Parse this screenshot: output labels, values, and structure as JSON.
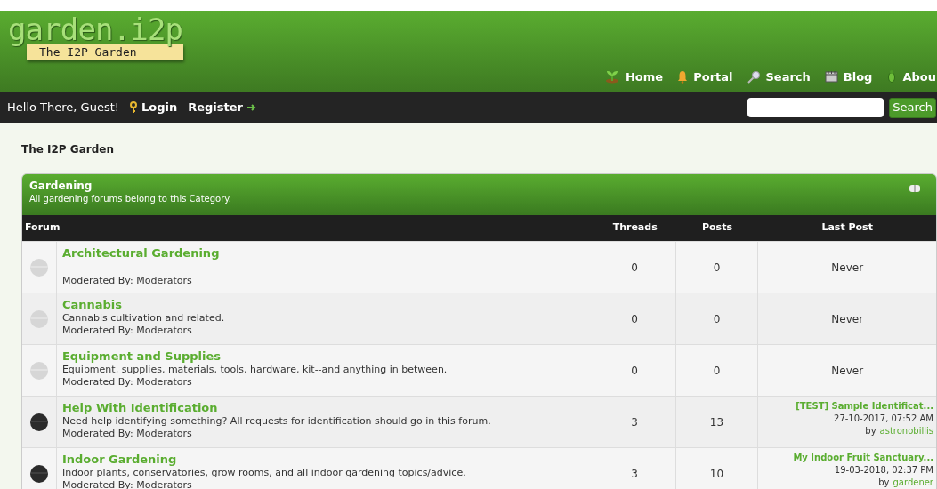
{
  "logo": {
    "title": "garden.i2p",
    "tagline": "The I2P Garden"
  },
  "nav": [
    {
      "label": "Home",
      "kind": "home"
    },
    {
      "label": "Portal",
      "kind": "portal"
    },
    {
      "label": "Search",
      "kind": "search"
    },
    {
      "label": "Blog",
      "kind": "blog"
    },
    {
      "label": "Abou",
      "kind": "about"
    }
  ],
  "user_bar": {
    "greeting": "Hello There, Guest!",
    "login": "Login",
    "register": "Register",
    "search_button": "Search"
  },
  "breadcrumb": "The I2P Garden",
  "category": {
    "title": "Gardening",
    "description": "All gardening forums belong to this Category."
  },
  "columns": [
    "Forum",
    "Threads",
    "Posts",
    "Last Post"
  ],
  "forums": [
    {
      "name": "Architectural Gardening",
      "moderators": "Moderated By: Moderators",
      "unread": false,
      "threads": "0",
      "posts": "0",
      "last_post": {
        "kind": "never",
        "text": "Never"
      }
    },
    {
      "name": "Cannabis",
      "description": "Cannabis cultivation and related.",
      "moderators": "Moderated By: Moderators",
      "unread": false,
      "threads": "0",
      "posts": "0",
      "last_post": {
        "kind": "never",
        "text": "Never"
      }
    },
    {
      "name": "Equipment and Supplies",
      "description": "Equipment, supplies, materials, tools, hardware, kit--and anything in between.",
      "moderators": "Moderated By: Moderators",
      "unread": false,
      "threads": "0",
      "posts": "0",
      "last_post": {
        "kind": "never",
        "text": "Never"
      }
    },
    {
      "name": "Help With Identification",
      "description": "Need help identifying something? All requests for identification should go in this forum.",
      "moderators": "Moderated By: Moderators",
      "unread": true,
      "threads": "3",
      "posts": "13",
      "last_post": {
        "kind": "post",
        "title": "[TEST] Sample Identificat...",
        "date": "27-10-2017, 07:52 AM",
        "by": "by",
        "author": "astronobillis"
      }
    },
    {
      "name": "Indoor Gardening",
      "description": "Indoor plants, conservatories, grow rooms, and all indoor gardening topics/advice.",
      "moderators": "Moderated By: Moderators",
      "unread": true,
      "threads": "3",
      "posts": "10",
      "last_post": {
        "kind": "post",
        "title": "My Indoor Fruit Sanctuary...",
        "date": "19-03-2018, 02:37 PM",
        "by": "by",
        "author": "gardener"
      }
    }
  ]
}
